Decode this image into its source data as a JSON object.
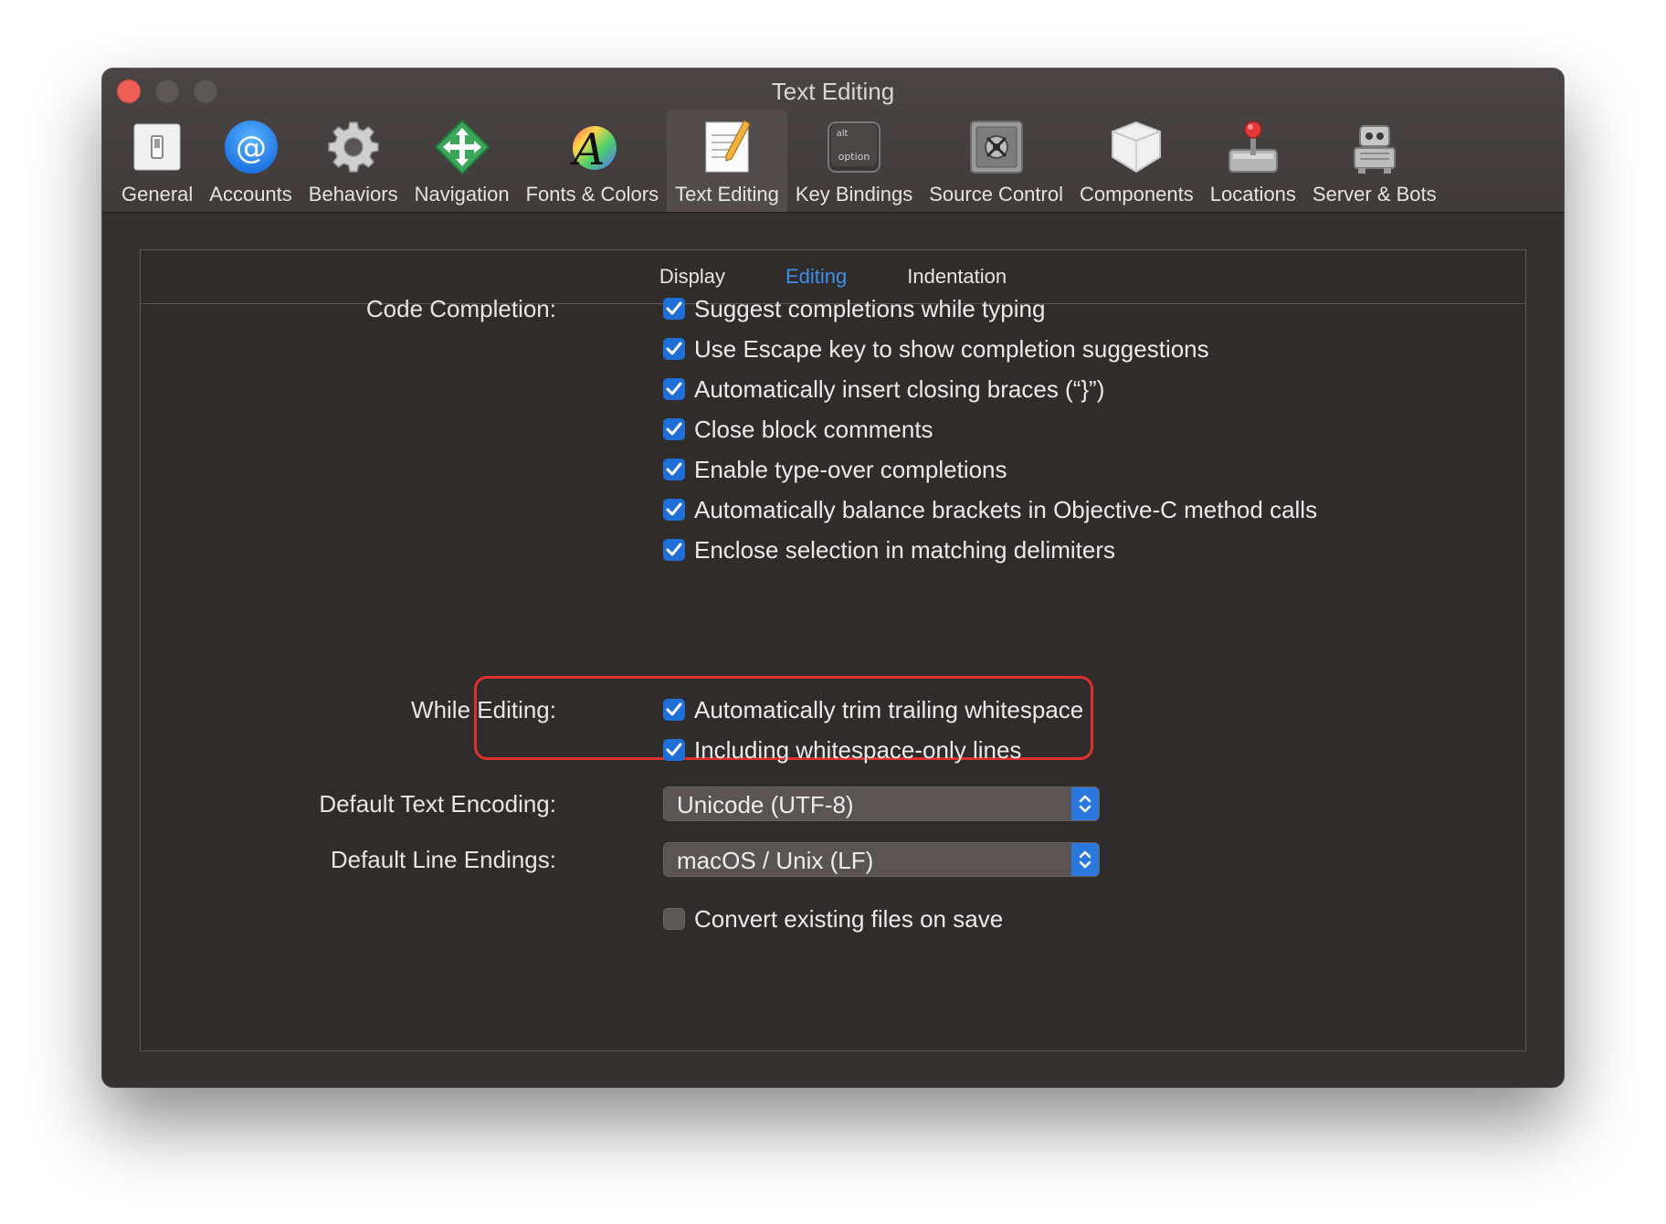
{
  "window": {
    "title": "Text Editing"
  },
  "toolbar": {
    "items": [
      {
        "label": "General",
        "icon": "general-switch-icon"
      },
      {
        "label": "Accounts",
        "icon": "at-sign-icon"
      },
      {
        "label": "Behaviors",
        "icon": "gear-icon"
      },
      {
        "label": "Navigation",
        "icon": "navigation-arrows-icon"
      },
      {
        "label": "Fonts & Colors",
        "icon": "font-letter-icon"
      },
      {
        "label": "Text Editing",
        "icon": "notepad-pencil-icon"
      },
      {
        "label": "Key Bindings",
        "icon": "option-key-icon"
      },
      {
        "label": "Source Control",
        "icon": "vault-safe-icon"
      },
      {
        "label": "Components",
        "icon": "component-box-icon"
      },
      {
        "label": "Locations",
        "icon": "joystick-drive-icon"
      },
      {
        "label": "Server & Bots",
        "icon": "robot-icon"
      }
    ],
    "selected": "Text Editing",
    "option_key_top": "alt",
    "option_key_bottom": "option"
  },
  "tabs": {
    "items": [
      "Display",
      "Editing",
      "Indentation"
    ],
    "active": "Editing"
  },
  "code_completion": {
    "label": "Code Completion:",
    "options": [
      {
        "text": "Suggest completions while typing",
        "checked": true
      },
      {
        "text": "Use Escape key to show completion suggestions",
        "checked": true
      },
      {
        "text": "Automatically insert closing braces (“}”)",
        "checked": true
      },
      {
        "text": "Close block comments",
        "checked": true
      },
      {
        "text": "Enable type-over completions",
        "checked": true
      },
      {
        "text": "Automatically balance brackets in Objective-C method calls",
        "checked": true
      },
      {
        "text": "Enclose selection in matching delimiters",
        "checked": true
      }
    ]
  },
  "while_editing": {
    "label": "While Editing:",
    "options": [
      {
        "text": "Automatically trim trailing whitespace",
        "checked": true
      },
      {
        "text": "Including whitespace-only lines",
        "checked": true
      }
    ]
  },
  "encoding": {
    "label": "Default Text Encoding:",
    "value": "Unicode (UTF-8)"
  },
  "line_endings": {
    "label": "Default Line Endings:",
    "value": "macOS / Unix (LF)"
  },
  "convert": {
    "text": "Convert existing files on save",
    "checked": false
  },
  "colors": {
    "accent": "#3d8fe7",
    "checkbox": "#1f6fd6",
    "highlight": "#e0302c"
  }
}
